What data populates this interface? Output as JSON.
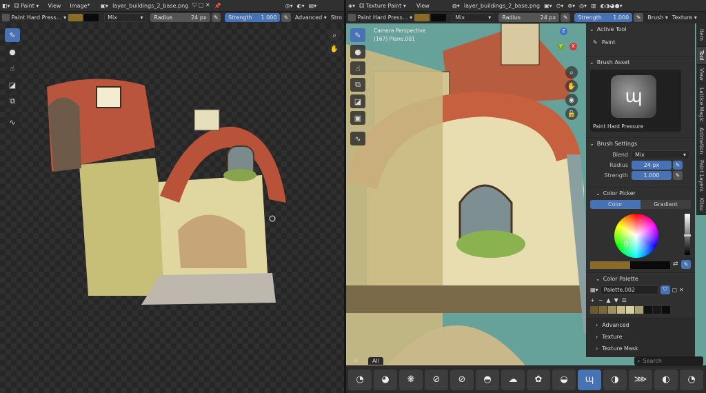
{
  "left": {
    "header": {
      "editor_icon": "image-editor-icon",
      "mode": "Paint",
      "view_menu": "View",
      "image_menu": "Image*",
      "image_name": "layer_buildings_2_base.png"
    },
    "toolsettings": {
      "brush_name": "Paint Hard Press…",
      "blend": "Mix",
      "radius_label": "Radius",
      "radius_value": "24 px",
      "strength_label": "Strength",
      "strength_value": "1.000",
      "advanced": "Advanced",
      "stroke": "Stro"
    },
    "tools": [
      "draw-brush-icon",
      "blur-icon",
      "smear-icon",
      "fill-icon",
      "clone-icon",
      "annotate-icon"
    ],
    "nav": [
      "zoom-icon",
      "pan-hand-icon"
    ]
  },
  "right": {
    "header": {
      "mode": "Texture Paint",
      "view_menu": "View",
      "image_name": "layer_buildings_2_base.png"
    },
    "toolsettings": {
      "brush_name": "Paint Hard Press…",
      "blend": "Mix",
      "radius_label": "Radius",
      "radius_value": "24 px",
      "strength_label": "Strength",
      "strength_value": "1.000",
      "brush_menu": "Brush",
      "texture_menu": "Texture"
    },
    "viewport": {
      "perspective": "Camera Perspective",
      "object": "(167) Plane.001"
    },
    "tools": [
      "draw-brush-icon",
      "blur-icon",
      "smear-icon",
      "clone-icon",
      "fill-icon",
      "mask-icon",
      "annotate-icon"
    ],
    "gizmo": {
      "x": "X",
      "y": "Y",
      "z": "Z"
    }
  },
  "sidebar": {
    "tabs": [
      "Item",
      "Tool",
      "View",
      "Lattice Magic",
      "Animation",
      "Paint Layers",
      "Kitsu"
    ],
    "active_tool": {
      "title": "Active Tool",
      "tool_name": "Paint"
    },
    "brush_asset": {
      "title": "Brush Asset",
      "name": "Paint Hard Pressure"
    },
    "brush_settings": {
      "title": "Brush Settings",
      "blend_label": "Blend",
      "blend_value": "Mix",
      "radius_label": "Radius",
      "radius_value": "24 px",
      "strength_label": "Strength",
      "strength_value": "1.000"
    },
    "color_picker": {
      "title": "Color Picker",
      "tab_color": "Color",
      "tab_gradient": "Gradient"
    },
    "color_palette": {
      "title": "Color Palette",
      "palette_name": "Palette.002",
      "swatches": [
        "#6b5a2e",
        "#7a6a3a",
        "#a09060",
        "#c8bc88",
        "#d8d0a0",
        "#a8a070",
        "#111111",
        "#181818",
        "#0c0c0c"
      ]
    },
    "collapsed": [
      "Advanced",
      "Texture",
      "Texture Mask"
    ]
  },
  "asset_shelf": {
    "all_tab": "All",
    "search_placeholder": "Search",
    "brushes": [
      "brush-1",
      "brush-2",
      "brush-3",
      "brush-4",
      "brush-5",
      "brush-6",
      "brush-7",
      "brush-8",
      "brush-9",
      "brush-10",
      "brush-11",
      "brush-12",
      "brush-13",
      "brush-14"
    ],
    "active_index": 9
  },
  "colors": {
    "primary": "#8a6c2a",
    "secondary": "#0a0a0a",
    "accent": "#4772b3"
  }
}
